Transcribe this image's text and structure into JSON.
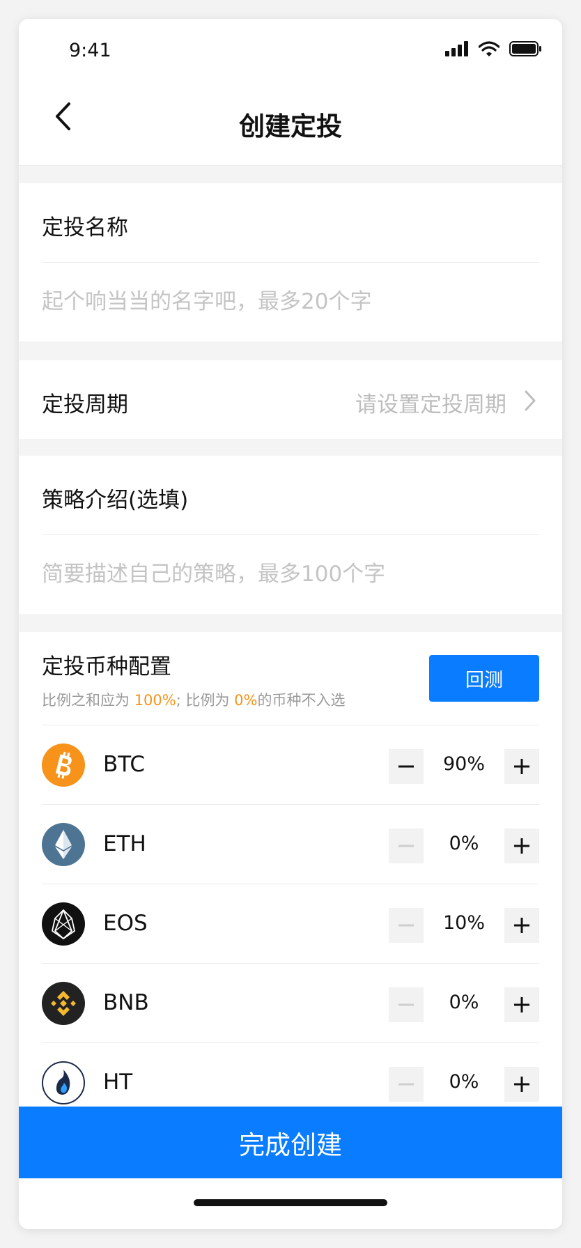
{
  "status_bar": {
    "time": "9:41"
  },
  "nav": {
    "title": "创建定投"
  },
  "name_section": {
    "label": "定投名称",
    "placeholder": "起个响当当的名字吧，最多20个字"
  },
  "period_section": {
    "label": "定投周期",
    "value": "请设置定投周期"
  },
  "intro_section": {
    "label": "策略介绍(选填)",
    "placeholder": "简要描述自己的策略，最多100个字"
  },
  "allocation": {
    "title": "定投币种配置",
    "subtitle_prefix": "比例之和应为 ",
    "subtitle_hl1": "100%",
    "subtitle_mid": "; 比例为 ",
    "subtitle_hl2": "0%",
    "subtitle_suffix": "的币种不入选",
    "backtest_label": "回测",
    "highlight_color": "#f7931a",
    "coins": [
      {
        "symbol": "BTC",
        "percent": "90%",
        "icon": "bitcoin-icon",
        "minus_enabled": true
      },
      {
        "symbol": "ETH",
        "percent": "0%",
        "icon": "ethereum-icon",
        "minus_enabled": false
      },
      {
        "symbol": "EOS",
        "percent": "10%",
        "icon": "eos-icon",
        "minus_enabled": false
      },
      {
        "symbol": "BNB",
        "percent": "0%",
        "icon": "binance-icon",
        "minus_enabled": false
      },
      {
        "symbol": "HT",
        "percent": "0%",
        "icon": "huobi-token-icon",
        "minus_enabled": false
      }
    ]
  },
  "submit_label": "完成创建",
  "colors": {
    "accent": "#0a7cff",
    "background": "#f4f4f4"
  }
}
